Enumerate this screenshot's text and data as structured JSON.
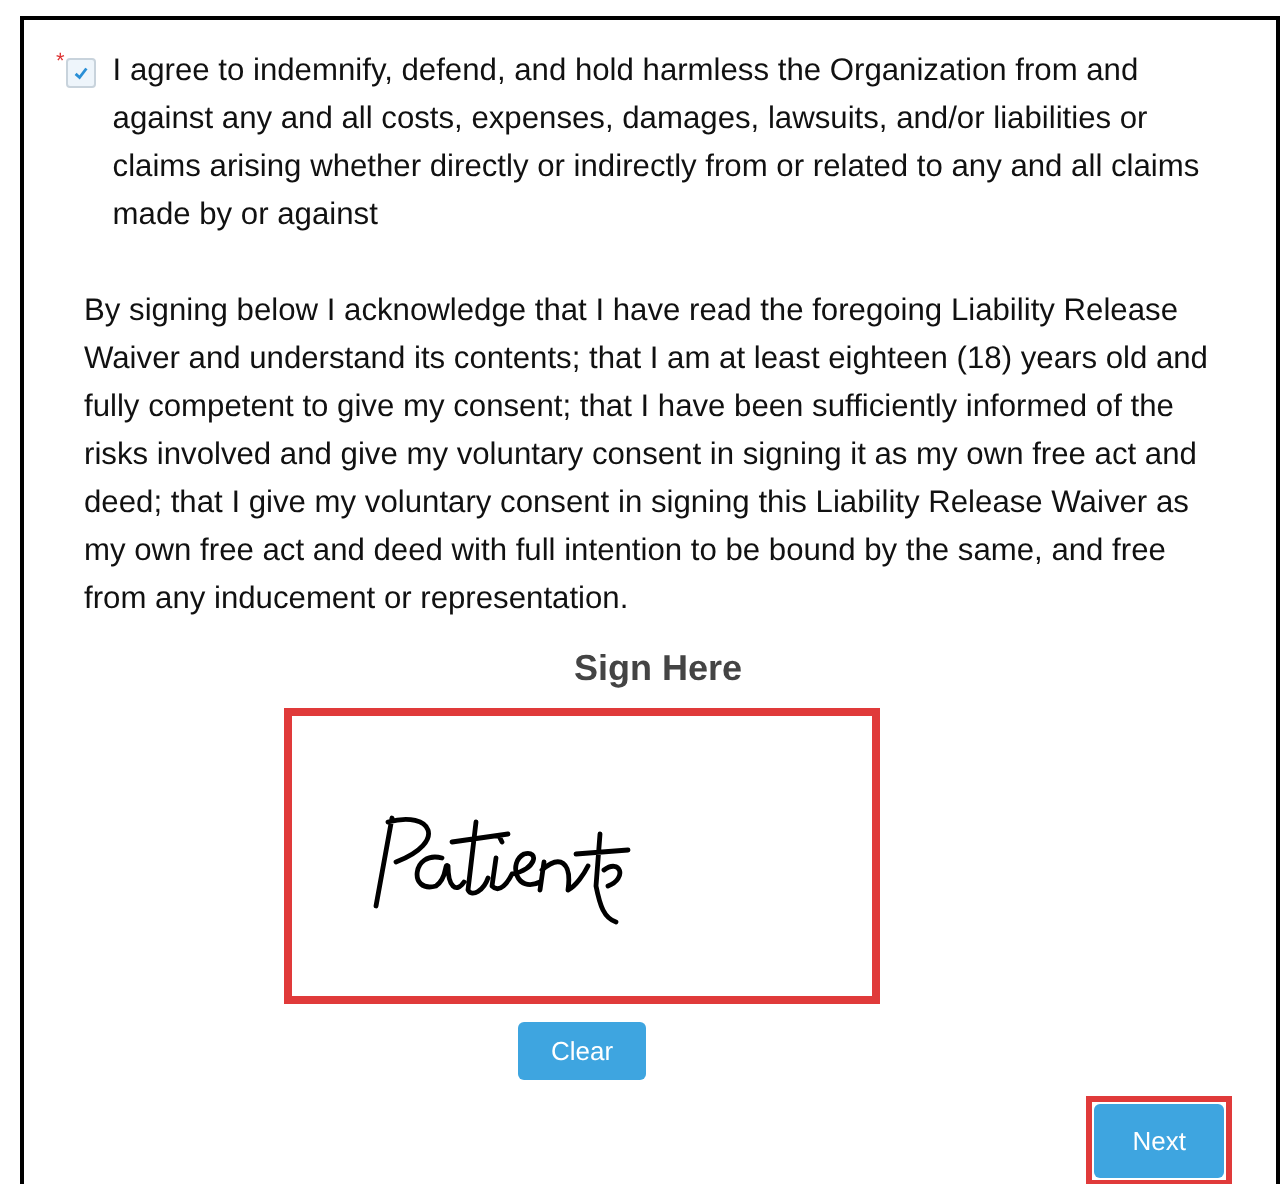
{
  "consent": {
    "required_mark": "*",
    "checked": true,
    "text": "I agree to indemnify, defend, and hold harmless the Organization from and against any and all costs, expenses, damages, lawsuits, and/or liabilities or claims arising whether directly or indirectly from or related to any and all claims made by or against"
  },
  "acknowledgement": "By signing below I acknowledge that I have read the foregoing Liability Release Waiver and understand its contents; that I am at least eighteen (18) years old and fully competent to give my consent; that I have been sufficiently informed of the risks involved and give my voluntary consent in signing it as my own free act and deed; that I give my voluntary consent in signing this Liability Release Waiver as my own free act and deed with full intention to be bound by the same, and free from any inducement or representation.",
  "signature": {
    "heading": "Sign Here",
    "signed": true,
    "highlighted": true
  },
  "buttons": [
    {
      "kind": "clear",
      "label": "Clear"
    },
    {
      "kind": "next",
      "label": "Next",
      "highlighted": true
    }
  ]
}
